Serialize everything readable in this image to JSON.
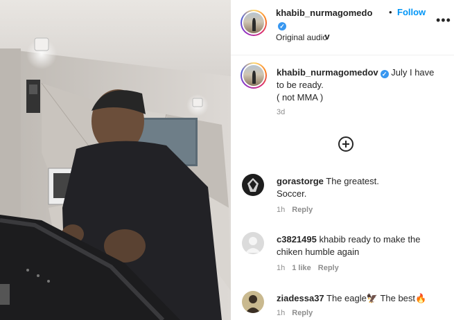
{
  "post": {
    "username": "khabib_nurmagomedo",
    "username_wrap": "v",
    "separator": "•",
    "follow_label": "Follow",
    "more_label": "•••",
    "audio": "Original audio"
  },
  "caption": {
    "username": "khabib_nurmagomedov",
    "text": " July I have to be ready.",
    "text2": "( not MMA )",
    "time": "3d"
  },
  "comments": [
    {
      "username": "gorastorge",
      "text": " The greatest.",
      "text2": "Soccer.",
      "time": "1h",
      "likes": "",
      "reply": "Reply"
    },
    {
      "username": "c3821495",
      "text": " khabib ready to make the chiken humble again",
      "text2": "",
      "time": "1h",
      "likes": "1 like",
      "reply": "Reply"
    },
    {
      "username": "ziadessa37",
      "text": " The eagle",
      "emoji1": "🦅",
      "text_b": " The best",
      "emoji2": "🔥",
      "time": "1h",
      "likes": "",
      "reply": "Reply"
    }
  ],
  "colors": {
    "accent": "#0095f6",
    "verified": "#3897f0",
    "muted": "#8e8e8e",
    "text": "#262626"
  },
  "icons": [
    "verified-badge-icon",
    "more-options-icon",
    "add-comment-icon"
  ]
}
